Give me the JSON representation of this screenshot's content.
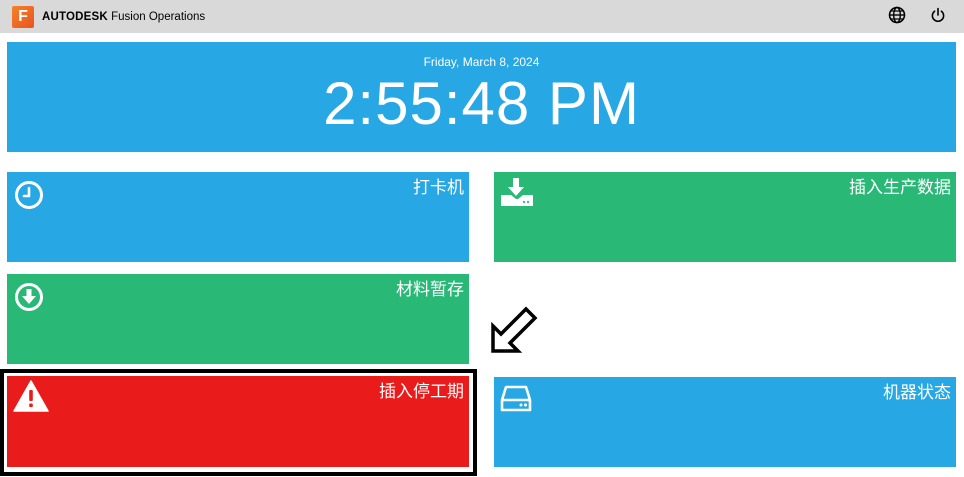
{
  "app": {
    "logo_letter": "F",
    "brand_name": "AUTODESK",
    "brand_product": "Fusion Operations"
  },
  "header": {
    "icons": [
      "globe-icon",
      "power-icon"
    ]
  },
  "clock": {
    "date": "Friday, March 8, 2024",
    "time": "2:55:48 PM"
  },
  "tiles": [
    {
      "label": "打卡机",
      "icon": "clock-icon",
      "color": "#27a7e3"
    },
    {
      "label": "插入生产数据",
      "icon": "download-tray-icon",
      "color": "#2ab877"
    },
    {
      "label": "材料暂存",
      "icon": "download-circle-icon",
      "color": "#2ab877"
    },
    {
      "label": "插入停工期",
      "icon": "warning-icon",
      "color": "#ea1b1b",
      "selected": true
    },
    {
      "label": "机器状态",
      "icon": "hard-drive-icon",
      "color": "#27a7e3"
    }
  ],
  "pointer": {
    "icon": "arrow-down-left-icon"
  }
}
